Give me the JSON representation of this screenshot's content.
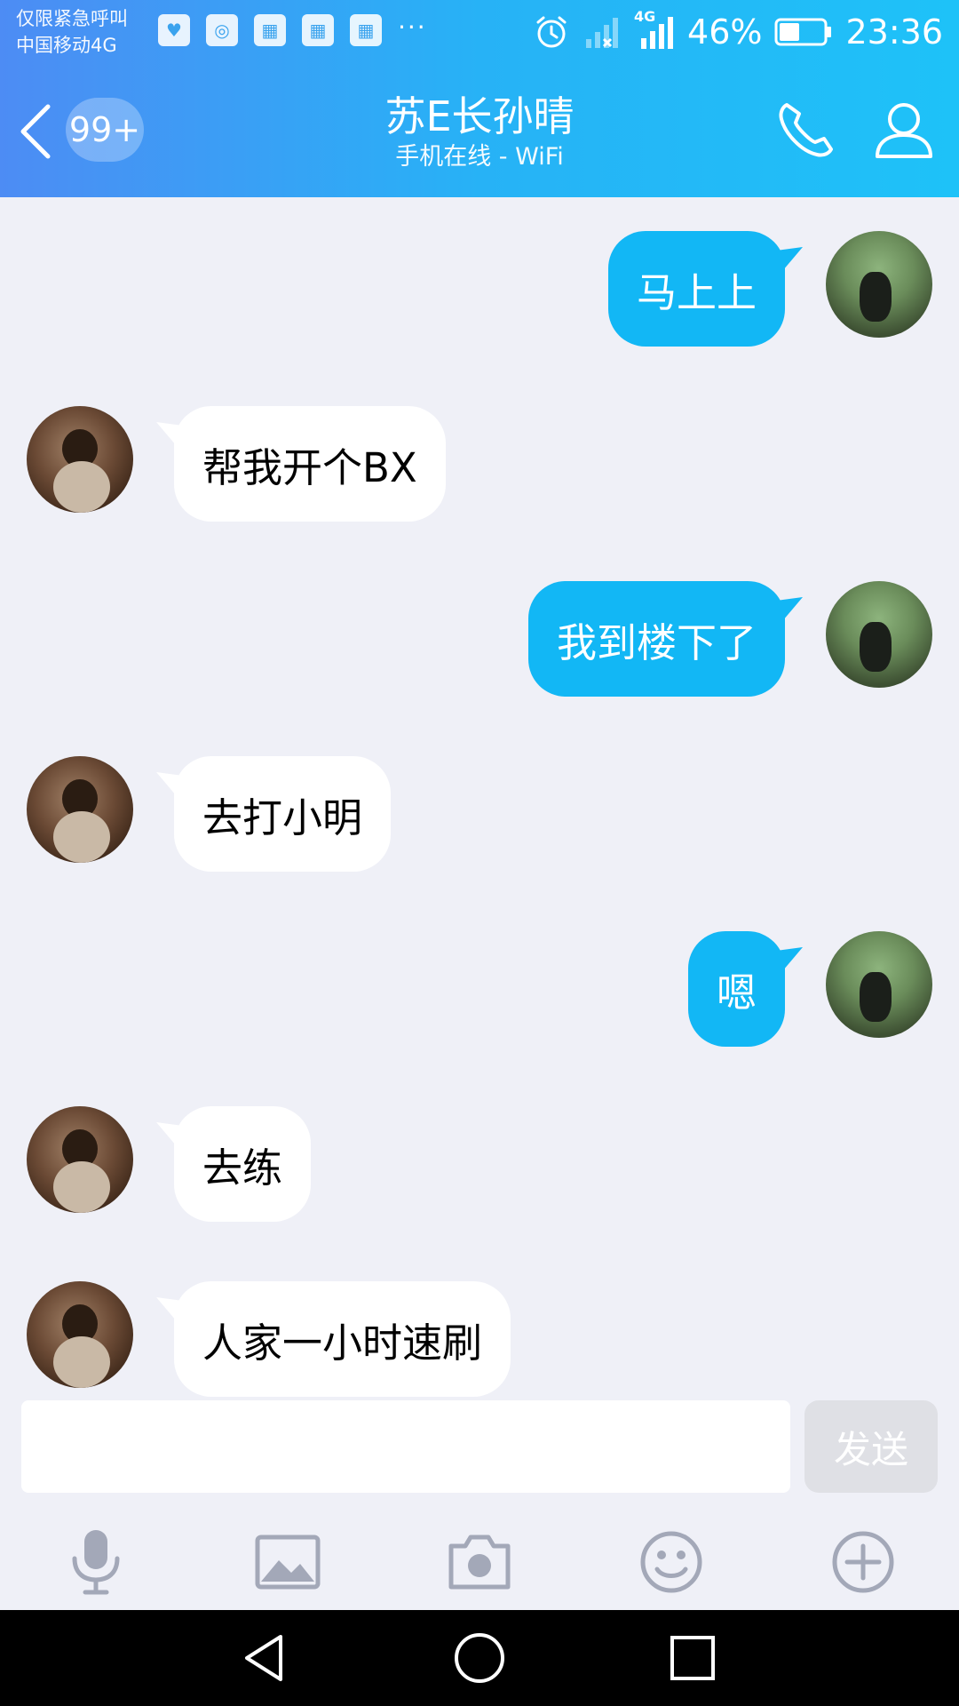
{
  "status_bar": {
    "carrier_line1": "仅限紧急呼叫",
    "carrier_line2": "中国移动4G",
    "more": "···",
    "network_type": "4G",
    "battery_percent": "46%",
    "battery_level": 0.46,
    "time": "23:36",
    "notification_icons": [
      "health-icon",
      "browser-icon",
      "photo-app-icon",
      "photo-app-icon",
      "photo-app-icon"
    ]
  },
  "header": {
    "unread_badge": "99+",
    "title": "苏E长孙晴",
    "subtitle": "手机在线 - WiFi"
  },
  "messages": [
    {
      "sender": "me",
      "text": "马上上"
    },
    {
      "sender": "other",
      "text": "帮我开个BX"
    },
    {
      "sender": "me",
      "text": "我到楼下了"
    },
    {
      "sender": "other",
      "text": "去打小明"
    },
    {
      "sender": "me",
      "text": "嗯"
    },
    {
      "sender": "other",
      "text": "去练"
    },
    {
      "sender": "other",
      "text": "人家一小时速刷"
    }
  ],
  "composer": {
    "input_value": "",
    "send_label": "发送"
  },
  "toolbar": {
    "icons": [
      "microphone-icon",
      "image-icon",
      "camera-icon",
      "emoji-icon",
      "plus-icon"
    ]
  },
  "colors": {
    "header_gradient_start": "#4d8cf4",
    "header_gradient_end": "#1ec2f8",
    "my_bubble": "#12b7f5",
    "other_bubble": "#ffffff",
    "background": "#eff0f7",
    "icon_gray": "#a3a8b8"
  }
}
